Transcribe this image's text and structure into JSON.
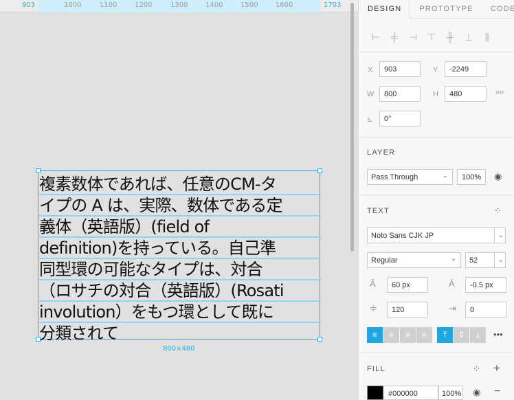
{
  "ruler": {
    "left_edge": "903",
    "right_edge": "1703",
    "ticks": [
      "1000",
      "1100",
      "1200",
      "1300",
      "1400",
      "1500",
      "1600"
    ]
  },
  "canvas": {
    "text_lines": [
      "複素数体であれば、任意のCM-タ",
      "イプの A は、実際、数体である定",
      "義体（英語版）(field of",
      "definition)を持っている。自己準",
      "同型環の可能なタイプは、対合",
      "（ロサチの対合（英語版）(Rosati",
      "involution）をもつ環として既に",
      "分類されて"
    ],
    "dimensions": "800×480"
  },
  "inspector": {
    "tabs": [
      "DESIGN",
      "PROTOTYPE",
      "CODE"
    ],
    "active_tab": "DESIGN",
    "x_label": "X",
    "x_value": "903",
    "y_label": "Y",
    "y_value": "-2249",
    "w_label": "W",
    "w_value": "800",
    "h_label": "H",
    "h_value": "480",
    "rotation": "0°",
    "layer": {
      "title": "LAYER",
      "blend": "Pass Through",
      "opacity": "100%"
    },
    "text": {
      "title": "TEXT",
      "font": "Noto Sans CJK JP",
      "weight": "Regular",
      "size": "52",
      "line_height": "60 px",
      "letter_spacing": "-0.5 px",
      "paragraph_spacing": "120",
      "paragraph_indent": "0"
    },
    "fill": {
      "title": "FILL",
      "color_hex": "#000000",
      "color": "#000000",
      "opacity": "100%"
    }
  },
  "colors": {
    "accent": "#21a6df",
    "selection": "#31a9dd"
  }
}
